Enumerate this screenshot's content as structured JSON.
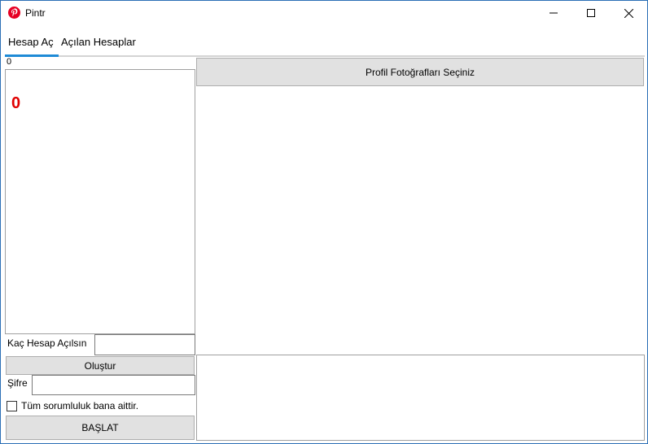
{
  "window": {
    "title": "Pintr",
    "icon": "pinterest-icon",
    "controls": [
      "minimize-icon",
      "maximize-icon",
      "close-icon"
    ]
  },
  "tabs": [
    {
      "label": "Hesap Aç",
      "active": true
    },
    {
      "label": "Açılan Hesaplar",
      "active": false
    }
  ],
  "left": {
    "counter_small": "0",
    "counter_big": "0",
    "count_label": "Kaç Hesap Açılsın",
    "count_value": "",
    "create_button": "Oluştur",
    "password_label": "Şifre",
    "password_value": "",
    "checkbox_label": "Tüm sorumluluk bana aittir.",
    "checkbox_checked": false,
    "start_button": "BAŞLAT"
  },
  "right": {
    "photos_button": "Profil Fotoğrafları Seçiniz"
  },
  "colors": {
    "accent": "#1e8ad6",
    "counter": "#e00000",
    "brand": "#e60023",
    "window_border": "#2b6fb6"
  }
}
